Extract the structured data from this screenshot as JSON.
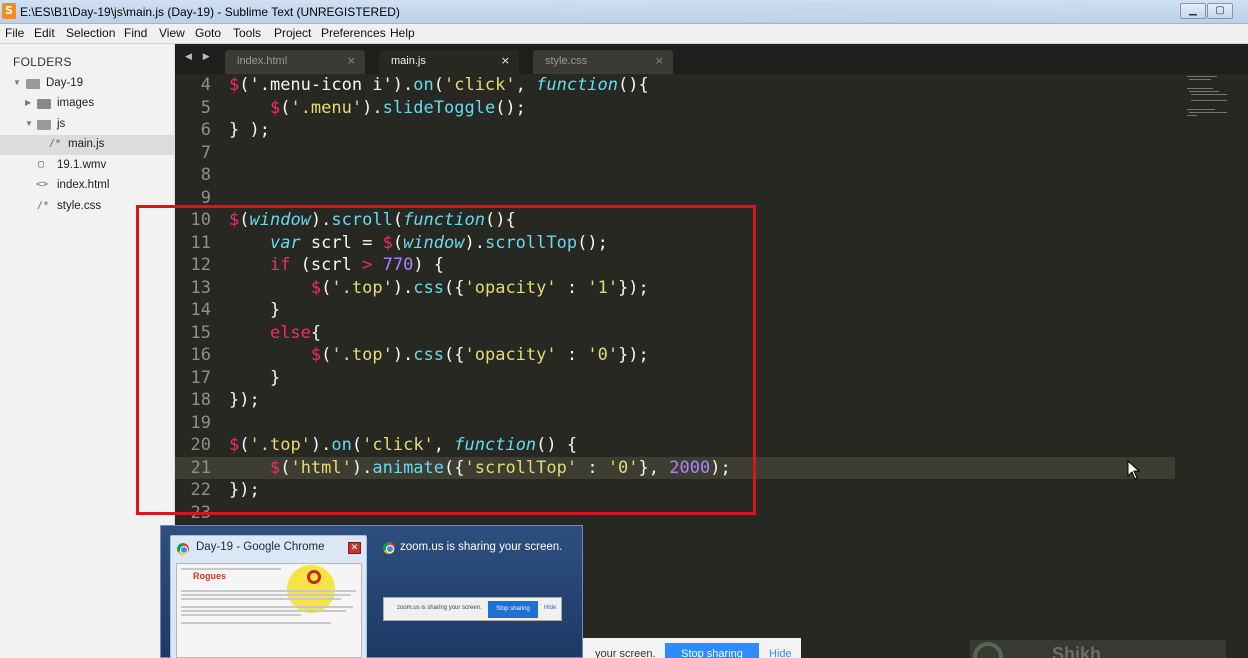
{
  "window": {
    "title": "E:\\ES\\B1\\Day-19\\js\\main.js (Day-19) - Sublime Text (UNREGISTERED)",
    "app_icon": "S",
    "controls": [
      "minimize-icon",
      "maximize-icon"
    ]
  },
  "menu": [
    "File",
    "Edit",
    "Selection",
    "Find",
    "View",
    "Goto",
    "Tools",
    "Project",
    "Preferences",
    "Help"
  ],
  "sidebar": {
    "header": "FOLDERS",
    "items": [
      {
        "label": "Day-19",
        "type": "folder-open",
        "depth": 0
      },
      {
        "label": "images",
        "type": "folder",
        "depth": 1
      },
      {
        "label": "js",
        "type": "folder-open",
        "depth": 1
      },
      {
        "label": "main.js",
        "type": "file",
        "glyph": "/*",
        "depth": 2,
        "selected": true
      },
      {
        "label": "19.1.wmv",
        "type": "file",
        "glyph": "▢",
        "depth": 1
      },
      {
        "label": "index.html",
        "type": "file",
        "glyph": "<>",
        "depth": 1
      },
      {
        "label": "style.css",
        "type": "file",
        "glyph": "/*",
        "depth": 1
      }
    ]
  },
  "tabs": [
    {
      "label": "index.html",
      "close": "×",
      "active": false
    },
    {
      "label": "main.js",
      "close": "×",
      "active": true
    },
    {
      "label": "style.css",
      "close": "×",
      "active": false
    }
  ],
  "tab_nav": "◀ ▶",
  "editor": {
    "current_line": 21,
    "lines": [
      {
        "num": "4",
        "tokens": [
          [
            "d",
            "$"
          ],
          [
            "w",
            "('.menu-icon i')."
          ],
          [
            "f",
            "on"
          ],
          [
            "w",
            "("
          ],
          [
            "s",
            "'click'"
          ],
          [
            "w",
            ", "
          ],
          [
            "i",
            "function"
          ],
          [
            "w",
            "(){"
          ]
        ]
      },
      {
        "num": "5",
        "tokens": [
          [
            "w",
            "    "
          ],
          [
            "d",
            "$"
          ],
          [
            "w",
            "("
          ],
          [
            "s",
            "'.menu'"
          ],
          [
            "w",
            ")."
          ],
          [
            "f",
            "slideToggle"
          ],
          [
            "w",
            "();"
          ]
        ]
      },
      {
        "num": "6",
        "tokens": [
          [
            "w",
            "} );"
          ]
        ]
      },
      {
        "num": "7",
        "tokens": []
      },
      {
        "num": "8",
        "tokens": []
      },
      {
        "num": "9",
        "tokens": []
      },
      {
        "num": "10",
        "tokens": [
          [
            "d",
            "$"
          ],
          [
            "w",
            "("
          ],
          [
            "i",
            "window"
          ],
          [
            "w",
            ")."
          ],
          [
            "f",
            "scroll"
          ],
          [
            "w",
            "("
          ],
          [
            "i",
            "function"
          ],
          [
            "w",
            "(){"
          ]
        ]
      },
      {
        "num": "11",
        "tokens": [
          [
            "w",
            "    "
          ],
          [
            "i",
            "var"
          ],
          [
            "w",
            " scrl = "
          ],
          [
            "d",
            "$"
          ],
          [
            "w",
            "("
          ],
          [
            "i",
            "window"
          ],
          [
            "w",
            ")."
          ],
          [
            "f",
            "scrollTop"
          ],
          [
            "w",
            "();"
          ]
        ]
      },
      {
        "num": "12",
        "tokens": [
          [
            "w",
            "    "
          ],
          [
            "k",
            "if"
          ],
          [
            "w",
            " (scrl "
          ],
          [
            "k",
            ">"
          ],
          [
            "w",
            " "
          ],
          [
            "n",
            "770"
          ],
          [
            "w",
            ") {"
          ]
        ]
      },
      {
        "num": "13",
        "tokens": [
          [
            "w",
            "        "
          ],
          [
            "d",
            "$"
          ],
          [
            "w",
            "("
          ],
          [
            "s",
            "'.top'"
          ],
          [
            "w",
            ")."
          ],
          [
            "f",
            "css"
          ],
          [
            "w",
            "({"
          ],
          [
            "s",
            "'opacity'"
          ],
          [
            "w",
            " : "
          ],
          [
            "s",
            "'1'"
          ],
          [
            "w",
            "});"
          ]
        ]
      },
      {
        "num": "14",
        "tokens": [
          [
            "w",
            "    }"
          ]
        ]
      },
      {
        "num": "15",
        "tokens": [
          [
            "w",
            "    "
          ],
          [
            "k",
            "else"
          ],
          [
            "w",
            "{"
          ]
        ]
      },
      {
        "num": "16",
        "tokens": [
          [
            "w",
            "        "
          ],
          [
            "d",
            "$"
          ],
          [
            "w",
            "("
          ],
          [
            "s",
            "'.top'"
          ],
          [
            "w",
            ")."
          ],
          [
            "f",
            "css"
          ],
          [
            "w",
            "({"
          ],
          [
            "s",
            "'opacity'"
          ],
          [
            "w",
            " : "
          ],
          [
            "s",
            "'0'"
          ],
          [
            "w",
            "});"
          ]
        ]
      },
      {
        "num": "17",
        "tokens": [
          [
            "w",
            "    }"
          ]
        ]
      },
      {
        "num": "18",
        "tokens": [
          [
            "w",
            "});"
          ]
        ]
      },
      {
        "num": "19",
        "tokens": []
      },
      {
        "num": "20",
        "tokens": [
          [
            "d",
            "$"
          ],
          [
            "w",
            "("
          ],
          [
            "s",
            "'.top'"
          ],
          [
            "w",
            ")."
          ],
          [
            "f",
            "on"
          ],
          [
            "w",
            "("
          ],
          [
            "s",
            "'click'"
          ],
          [
            "w",
            ", "
          ],
          [
            "i",
            "function"
          ],
          [
            "w",
            "() {"
          ]
        ]
      },
      {
        "num": "21",
        "tokens": [
          [
            "w",
            "    "
          ],
          [
            "d",
            "$"
          ],
          [
            "w",
            "("
          ],
          [
            "s",
            "'html'"
          ],
          [
            "w",
            ")."
          ],
          [
            "f",
            "animate"
          ],
          [
            "w",
            "({"
          ],
          [
            "s",
            "'scrollTop'"
          ],
          [
            "w",
            " : "
          ],
          [
            "s",
            "'0'"
          ],
          [
            "w",
            "}, "
          ],
          [
            "n",
            "2000"
          ],
          [
            "w",
            ");"
          ]
        ]
      },
      {
        "num": "22",
        "tokens": [
          [
            "w",
            "});"
          ]
        ]
      },
      {
        "num": "23",
        "tokens": []
      }
    ],
    "annotation_color": "#d8151b",
    "cursor_icon": "mouse-pointer-icon"
  },
  "syntax_colors": {
    "d": "#f92672",
    "f": "#66d9ef",
    "s": "#e6db74",
    "i": "#66d9ef",
    "k": "#f92672",
    "n": "#ae81ff",
    "w": "#f8f8f2"
  },
  "taskbar_popup": {
    "thumbnail_title": "Day-19 - Google Chrome",
    "thumbnail_close": "✕",
    "thumbnail_logo": "Rogues",
    "zoom_title": "zoom.us is sharing your screen.",
    "zoom_mini_text": "zoom.us is sharing your screen.",
    "zoom_mini_stop": "Stop sharing",
    "zoom_mini_hide": "Hide"
  },
  "share_bar": {
    "text": "your screen.",
    "stop": "Stop sharing",
    "hide": "Hide"
  },
  "watermark": {
    "text": "Shikh"
  }
}
